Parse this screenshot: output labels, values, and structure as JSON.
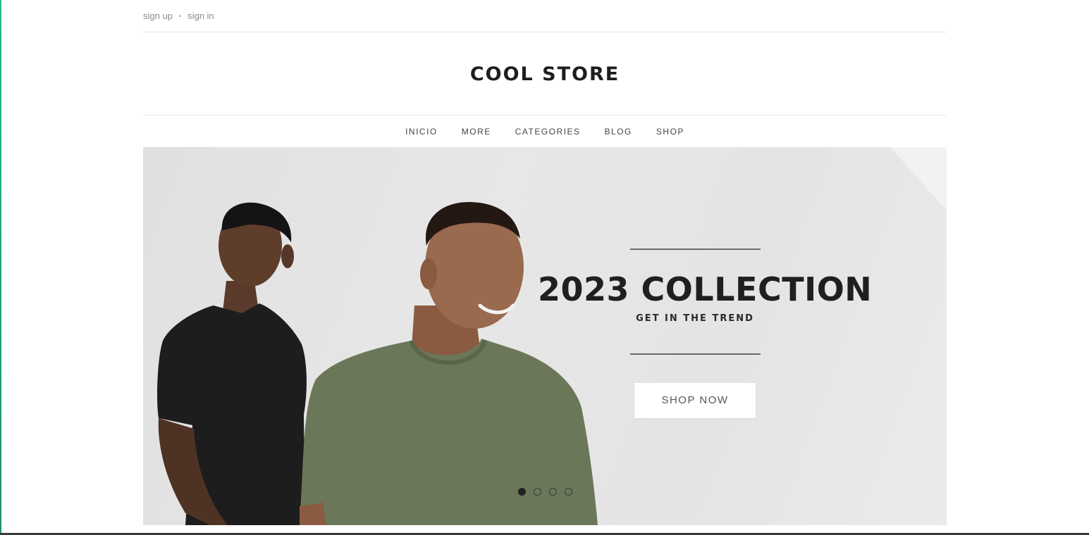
{
  "topbar": {
    "signup": "sign up",
    "separator": "•",
    "signin": "sign in"
  },
  "brand": {
    "logo": "COOL STORE"
  },
  "nav": {
    "items": [
      {
        "label": "INICIO"
      },
      {
        "label": "MORE"
      },
      {
        "label": "CATEGORIES"
      },
      {
        "label": "BLOG"
      },
      {
        "label": "SHOP"
      }
    ]
  },
  "hero": {
    "title": "2023 COLLECTION",
    "subtitle": "GET IN THE TREND",
    "cta": "SHOP NOW",
    "image": "two-men-in-tshirts-photo",
    "slides": {
      "count": 4,
      "active": 1
    }
  },
  "colors": {
    "text_dark": "#1f1f1f",
    "hero_bg": "#e4e4e4",
    "shirt_green": "#6b7759",
    "shirt_black": "#1c1c1c",
    "accent_edge": "#2bb58a"
  }
}
